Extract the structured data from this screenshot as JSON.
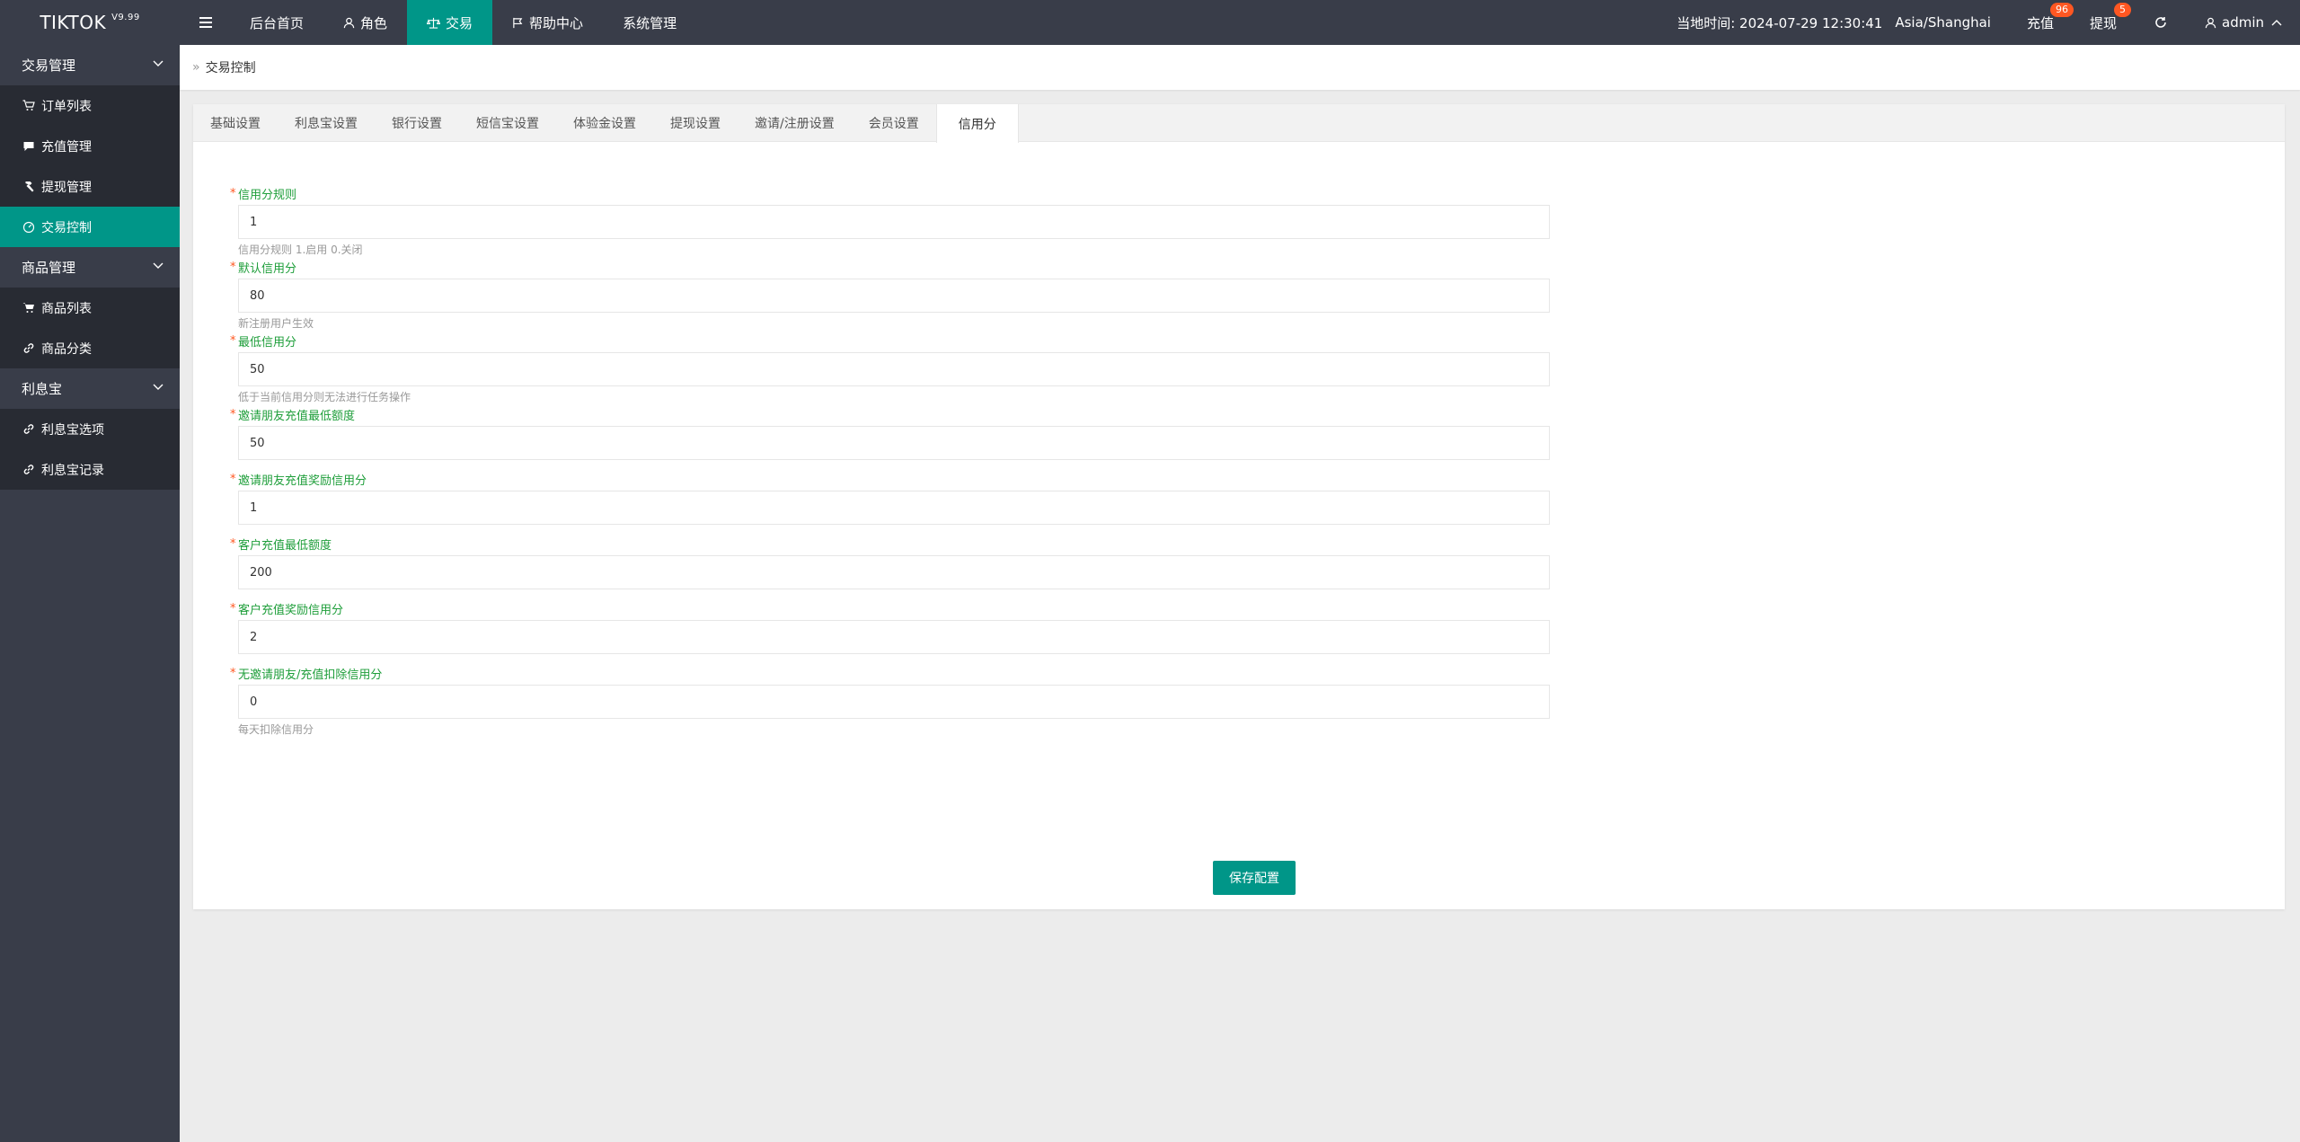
{
  "app": {
    "name": "TIKTOK",
    "version": "V9.99"
  },
  "topnav": {
    "items": [
      {
        "label": "后台首页"
      },
      {
        "label": "角色"
      },
      {
        "label": "交易"
      },
      {
        "label": "帮助中心"
      },
      {
        "label": "系统管理"
      }
    ]
  },
  "header": {
    "time_label": "当地时间: 2024-07-29 12:30:41",
    "timezone": "Asia/Shanghai",
    "recharge": {
      "label": "充值",
      "badge": "96"
    },
    "withdraw": {
      "label": "提现",
      "badge": "5"
    },
    "user": "admin"
  },
  "sidebar": {
    "groups": [
      {
        "label": "交易管理",
        "items": [
          {
            "label": "订单列表",
            "icon": "cart-icon"
          },
          {
            "label": "充值管理",
            "icon": "chat-icon"
          },
          {
            "label": "提现管理",
            "icon": "hammer-icon"
          },
          {
            "label": "交易控制",
            "icon": "gauge-icon"
          }
        ]
      },
      {
        "label": "商品管理",
        "items": [
          {
            "label": "商品列表",
            "icon": "cart-icon"
          },
          {
            "label": "商品分类",
            "icon": "link-icon"
          }
        ]
      },
      {
        "label": "利息宝",
        "items": [
          {
            "label": "利息宝选项",
            "icon": "link-icon"
          },
          {
            "label": "利息宝记录",
            "icon": "link-icon"
          }
        ]
      }
    ]
  },
  "breadcrumb": {
    "current": "交易控制"
  },
  "tabs": [
    {
      "label": "基础设置"
    },
    {
      "label": "利息宝设置"
    },
    {
      "label": "银行设置"
    },
    {
      "label": "短信宝设置"
    },
    {
      "label": "体验金设置"
    },
    {
      "label": "提现设置"
    },
    {
      "label": "邀请/注册设置"
    },
    {
      "label": "会员设置"
    },
    {
      "label": "信用分"
    }
  ],
  "form": {
    "fields": [
      {
        "label": "信用分规则",
        "value": "1",
        "hint": "信用分规则 1.启用 0.关闭"
      },
      {
        "label": "默认信用分",
        "value": "80",
        "hint": "新注册用户生效"
      },
      {
        "label": "最低信用分",
        "value": "50",
        "hint": "低于当前信用分则无法进行任务操作"
      },
      {
        "label": "邀请朋友充值最低额度",
        "value": "50",
        "hint": ""
      },
      {
        "label": "邀请朋友充值奖励信用分",
        "value": "1",
        "hint": ""
      },
      {
        "label": "客户充值最低额度",
        "value": "200",
        "hint": ""
      },
      {
        "label": "客户充值奖励信用分",
        "value": "2",
        "hint": ""
      },
      {
        "label": "无邀请朋友/充值扣除信用分",
        "value": "0",
        "hint": "每天扣除信用分"
      }
    ],
    "save_label": "保存配置"
  },
  "colors": {
    "accent": "#009688",
    "dark": "#393d49",
    "submenu": "#282b33",
    "label": "#1e9e3a",
    "badge": "#ff5722"
  }
}
